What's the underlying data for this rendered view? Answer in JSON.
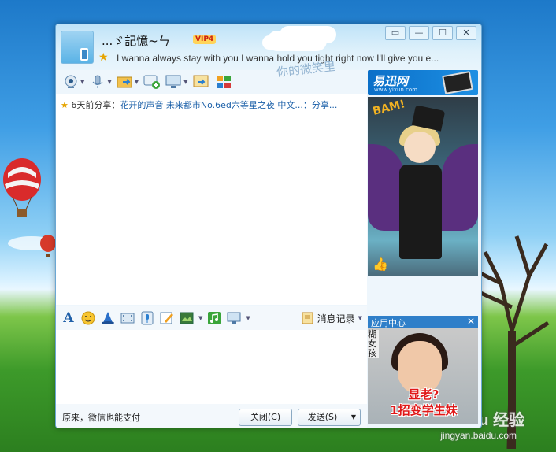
{
  "desktop": {
    "watermark_line1": "Bai du 经验",
    "watermark_line2": "jingyan.baidu.com"
  },
  "title": {
    "nickname": "...ゞ記憶~ㄣ",
    "vip_badge": "VIP4",
    "signature": "I wanna always stay with you    I wanna hold you tight right now    I'll give you e..."
  },
  "window_controls": {
    "skin": "▭",
    "minimize": "—",
    "maximize": "☐",
    "close": "✕"
  },
  "toolbar": {
    "decorative_text": "你的微笑里"
  },
  "chat": {
    "share_prefix": "6天前分享：",
    "share_text": "花开的声音 未来都市No.6ed六等星之夜 中文...：分享..."
  },
  "input_toolbar": {
    "history_label": "消息记录"
  },
  "bottom": {
    "tip": "原来，微信也能支付",
    "close_label": "关闭(C)",
    "send_label": "发送(S)",
    "send_caret": "▼"
  },
  "ad": {
    "brand": "易迅网",
    "url": "www.yixun.com"
  },
  "show": {
    "word": "BAM!"
  },
  "app_center": {
    "title": "应用中心",
    "close": "✕",
    "side_text": "糊女孩",
    "caption_line1": "显老?",
    "caption_line2": "1招变学生妹"
  }
}
